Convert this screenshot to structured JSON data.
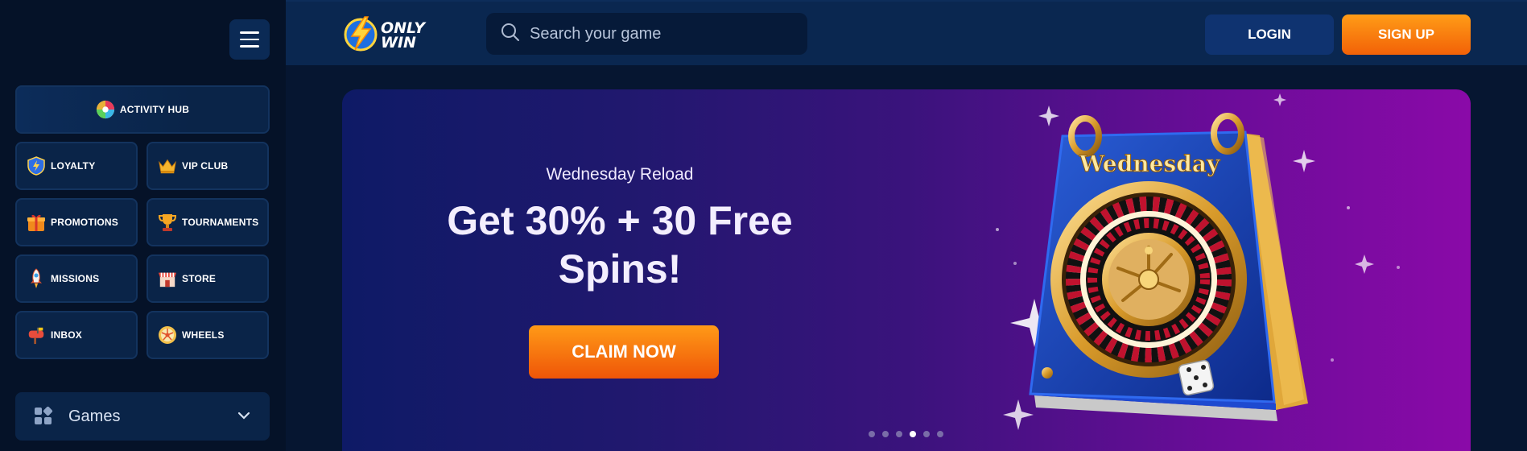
{
  "sidebar": {
    "hub": {
      "label": "ACTIVITY HUB",
      "icon": "activity-hub-icon"
    },
    "items": [
      {
        "label": "LOYALTY",
        "icon": "loyalty-shield-icon"
      },
      {
        "label": "VIP CLUB",
        "icon": "crown-icon"
      },
      {
        "label": "PROMOTIONS",
        "icon": "gift-icon"
      },
      {
        "label": "TOURNAMENTS",
        "icon": "trophy-icon"
      },
      {
        "label": "MISSIONS",
        "icon": "rocket-icon"
      },
      {
        "label": "STORE",
        "icon": "store-icon"
      },
      {
        "label": "INBOX",
        "icon": "mailbox-icon"
      },
      {
        "label": "WHEELS",
        "icon": "wheel-icon"
      }
    ],
    "games": {
      "label": "Games",
      "icon": "games-grid-icon"
    }
  },
  "header": {
    "logo_line1": "ONLY",
    "logo_line2": "WIN",
    "search_placeholder": "Search your game",
    "login_label": "LOGIN",
    "signup_label": "SIGN UP"
  },
  "banner": {
    "subtitle": "Wednesday Reload",
    "title": "Get 30% + 30 Free Spins!",
    "cta_label": "CLAIM NOW",
    "calendar_text": "Wednesday",
    "slide_count": 6,
    "active_slide": 4
  },
  "colors": {
    "background": "#061631",
    "sidebar": "#051228",
    "header": "#0a2750",
    "tile": "#0a2448",
    "accent_orange": "#f77a0c",
    "login_blue": "#0f3370",
    "banner_start": "#0e1a66",
    "banner_end": "#8a0aa8"
  }
}
